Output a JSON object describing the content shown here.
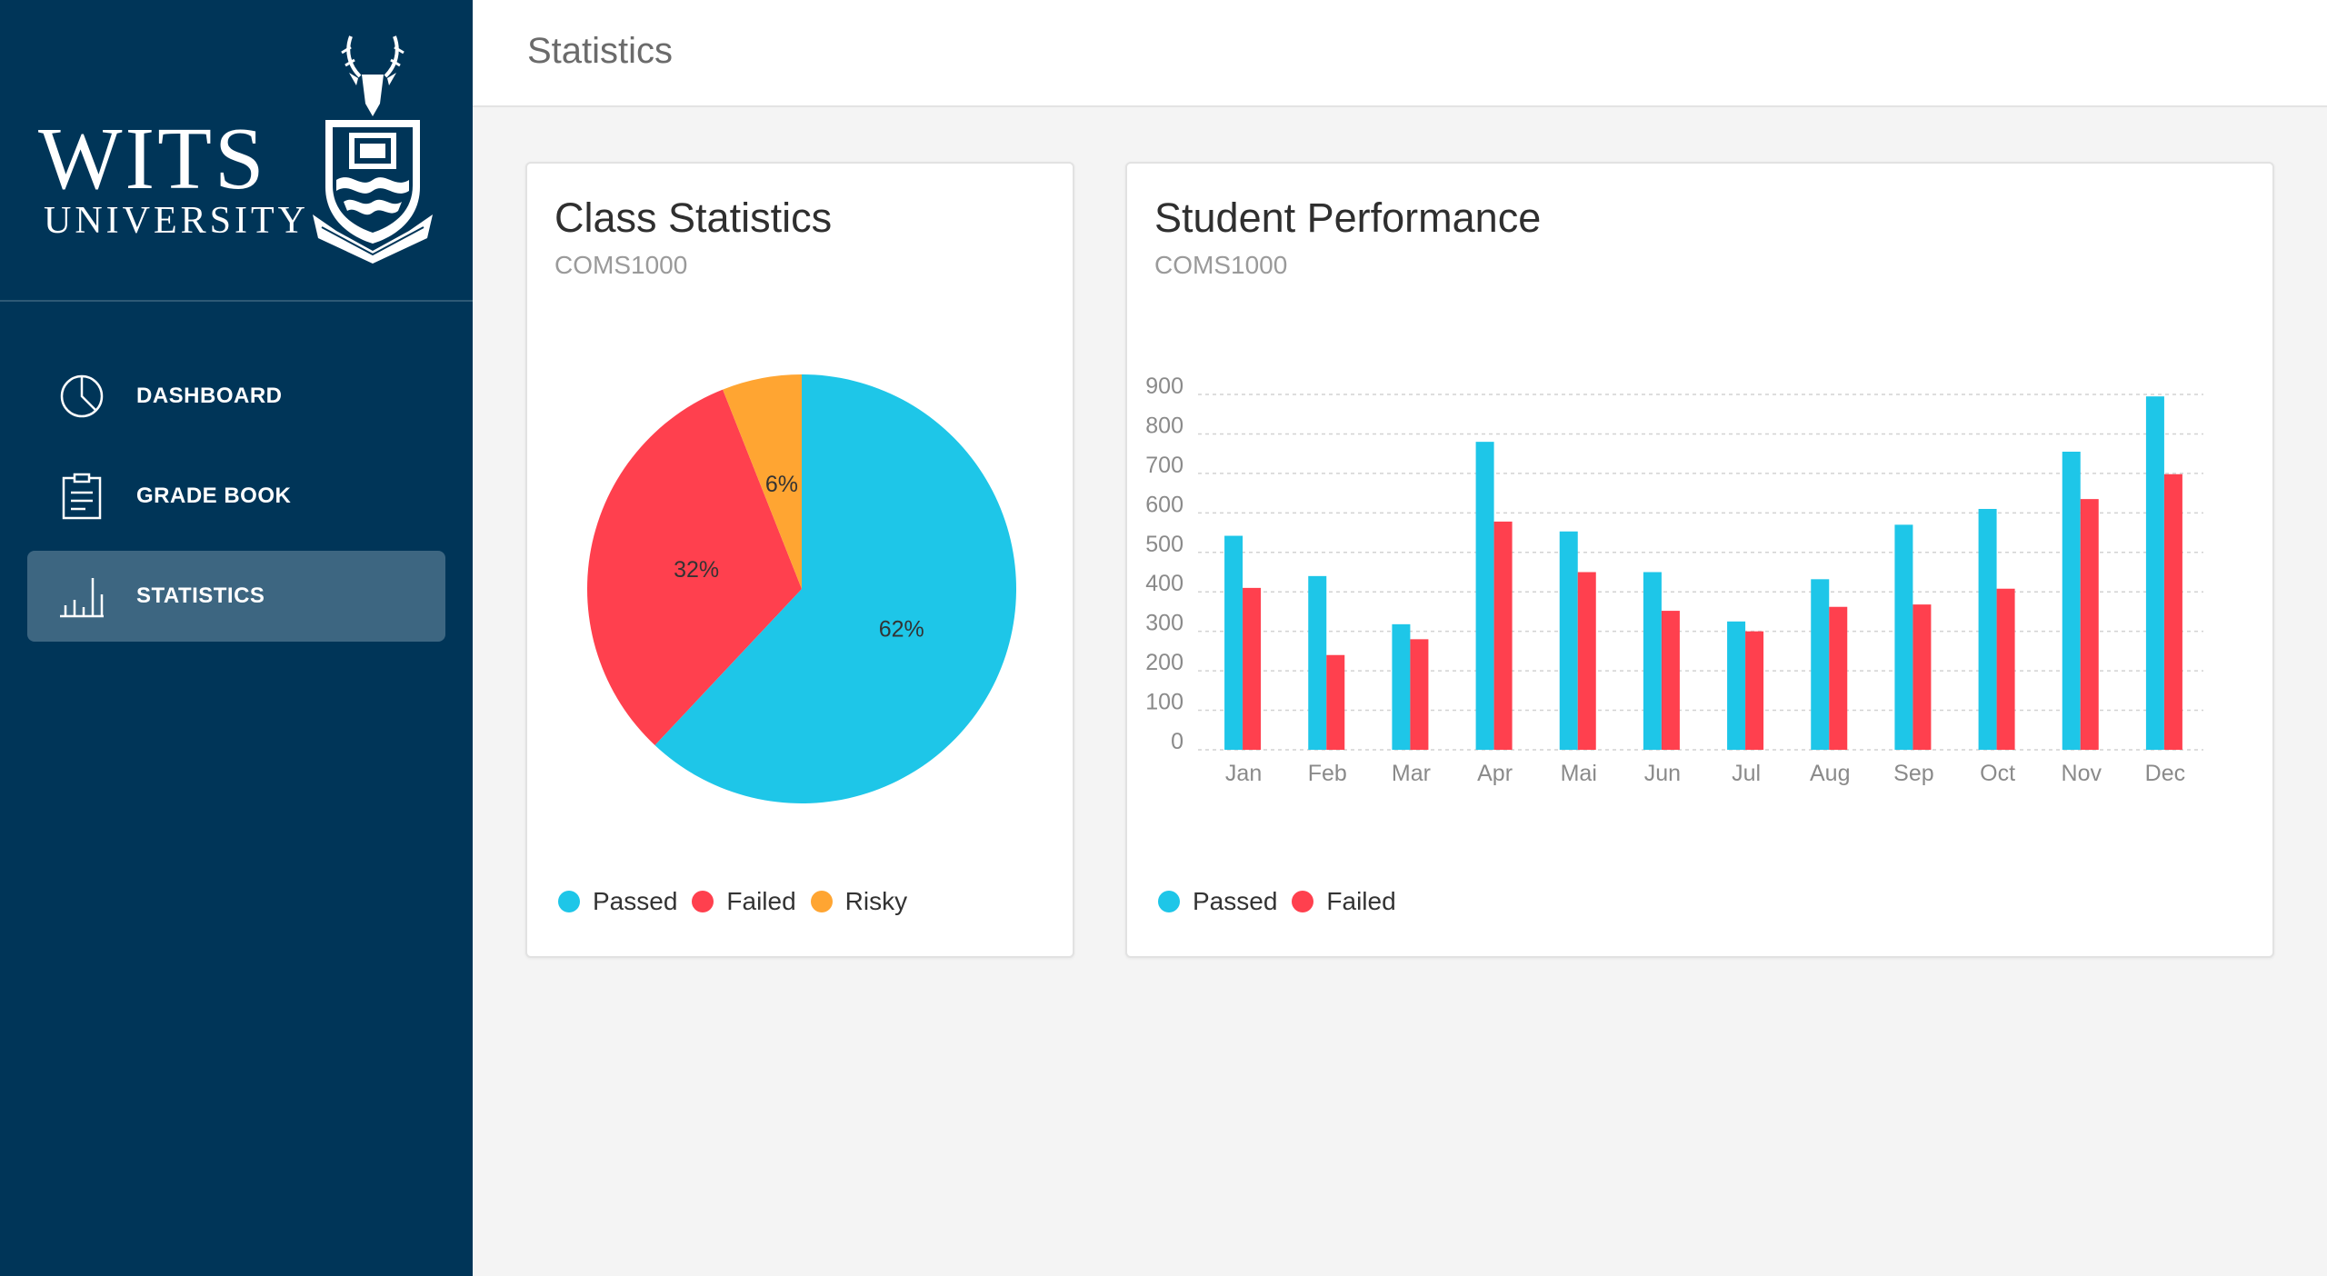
{
  "sidebar": {
    "brand": {
      "name": "WITS",
      "subtitle": "UNIVERSITY"
    },
    "items": [
      {
        "label": "DASHBOARD",
        "icon": "pie-chart-icon",
        "active": false
      },
      {
        "label": "GRADE BOOK",
        "icon": "clipboard-icon",
        "active": false
      },
      {
        "label": "STATISTICS",
        "icon": "bar-chart-icon",
        "active": true
      }
    ]
  },
  "header": {
    "title": "Statistics"
  },
  "colors": {
    "sidebar": "#003558",
    "active_item": "#3d6681",
    "passed": "#1ec6e8",
    "failed": "#ff404e",
    "risky": "#ffa532"
  },
  "class_stats": {
    "title": "Class Statistics",
    "subtitle": "COMS1000",
    "legend": [
      "Passed",
      "Failed",
      "Risky"
    ]
  },
  "performance": {
    "title": "Student Performance",
    "subtitle": "COMS1000",
    "legend": [
      "Passed",
      "Failed"
    ]
  },
  "chart_data": [
    {
      "type": "pie",
      "title": "Class Statistics",
      "subtitle": "COMS1000",
      "categories": [
        "Passed",
        "Failed",
        "Risky"
      ],
      "values": [
        62,
        32,
        6
      ],
      "labels": [
        "62%",
        "32%",
        "6%"
      ],
      "colors": [
        "#1ec6e8",
        "#ff404e",
        "#ffa532"
      ],
      "legend_position": "bottom-left"
    },
    {
      "type": "bar",
      "title": "Student Performance",
      "subtitle": "COMS1000",
      "categories": [
        "Jan",
        "Feb",
        "Mar",
        "Apr",
        "Mai",
        "Jun",
        "Jul",
        "Aug",
        "Sep",
        "Oct",
        "Nov",
        "Dec"
      ],
      "series": [
        {
          "name": "Passed",
          "color": "#1ec6e8",
          "values": [
            542,
            440,
            318,
            780,
            553,
            450,
            325,
            432,
            570,
            610,
            755,
            895
          ]
        },
        {
          "name": "Failed",
          "color": "#ff404e",
          "values": [
            410,
            240,
            280,
            578,
            450,
            352,
            300,
            362,
            368,
            408,
            635,
            698
          ]
        }
      ],
      "yticks": [
        0,
        100,
        200,
        300,
        400,
        500,
        600,
        700,
        800,
        900
      ],
      "ylim": [
        0,
        900
      ],
      "grid": true,
      "legend_position": "bottom-left"
    }
  ]
}
